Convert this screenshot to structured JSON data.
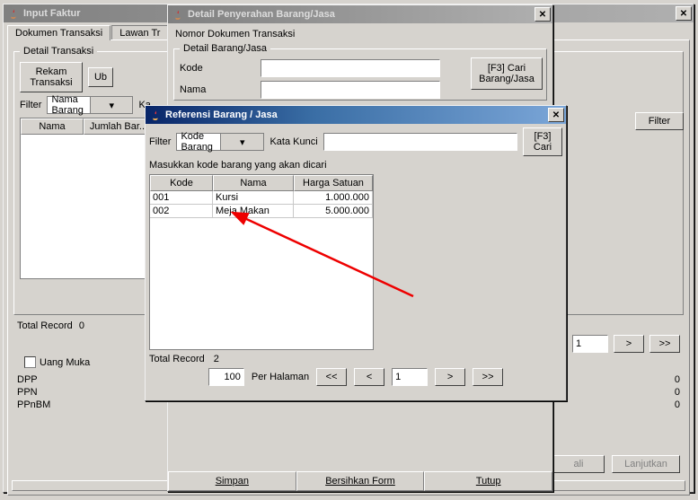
{
  "main": {
    "title": "Input Faktur",
    "tabs": [
      "Dokumen Transaksi",
      "Lawan Tr"
    ],
    "detail_legend": "Detail Transaksi",
    "rekam_btn": "Rekam\nTransaksi",
    "ub_btn": "Ub",
    "filter_label": "Filter",
    "filter_select": "Nama Barang",
    "kata_label": "Ka",
    "filter_btn": "Filter",
    "cols": [
      "Nama",
      "Jumlah Bar..."
    ],
    "total_record_label": "Total Record",
    "total_record_value": "0",
    "uang_muka": "Uang Muka",
    "dpp": "DPP",
    "ppn": "PPN",
    "ppnbm": "PPnBM",
    "val0": "0",
    "nav_page": "1",
    "nav_next": ">",
    "nav_last": ">>",
    "bottom_left": "ali",
    "bottom_right": "Lanjutkan"
  },
  "detail": {
    "title": "Detail Penyerahan Barang/Jasa",
    "nomor_label": "Nomor Dokumen Transaksi",
    "legend": "Detail Barang/Jasa",
    "kode_label": "Kode",
    "nama_label": "Nama",
    "f3_btn": "[F3] Cari\nBarang/Jasa",
    "simpan": "Simpan",
    "bersih": "Bersihkan Form",
    "tutup": "Tutup"
  },
  "ref": {
    "title": "Referensi Barang / Jasa",
    "filter_label": "Filter",
    "filter_select": "Kode Barang",
    "kk_label": "Kata Kunci",
    "f3_btn": "[F3]\nCari",
    "instr": "Masukkan kode barang yang akan dicari",
    "cols": [
      "Kode",
      "Nama",
      "Harga Satuan"
    ],
    "rows": [
      {
        "kode": "001",
        "nama": "Kursi",
        "harga": "1.000.000"
      },
      {
        "kode": "002",
        "nama": "Meja Makan",
        "harga": "5.000.000"
      }
    ],
    "total_record_label": "Total Record",
    "total_record_value": "2",
    "per_hal_value": "100",
    "per_hal_label": "Per Halaman",
    "nav_first": "<<",
    "nav_prev": "<",
    "nav_page": "1",
    "nav_next": ">",
    "nav_last": ">>"
  }
}
